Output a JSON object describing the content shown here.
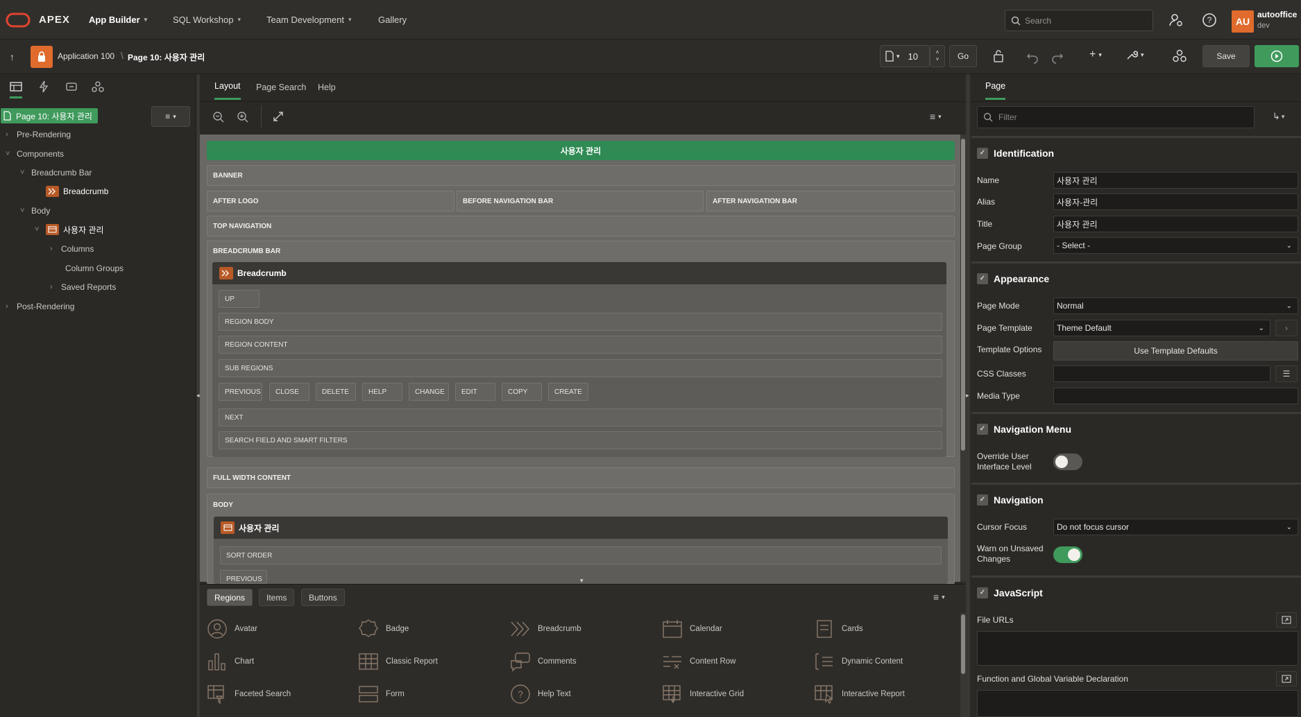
{
  "header": {
    "logo_text": "APEX",
    "nav": [
      {
        "label": "App Builder",
        "active": true
      },
      {
        "label": "SQL Workshop",
        "active": false
      },
      {
        "label": "Team Development",
        "active": false
      },
      {
        "label": "Gallery",
        "active": false
      }
    ],
    "search_placeholder": "Search",
    "user": {
      "initials": "AU",
      "name": "autooffice",
      "workspace": "dev"
    }
  },
  "toolbar": {
    "breadcrumb": [
      "Application 100",
      "Page 10: 사용자 관리"
    ],
    "page_number": "10",
    "go_label": "Go",
    "save_label": "Save",
    "colors": {
      "accent_green": "#3f9a5c",
      "brand_orange": "#e06b2c"
    }
  },
  "left_panel": {
    "page_chip": "Page 10: 사용자 관리",
    "tree": [
      {
        "label": "Pre-Rendering"
      },
      {
        "label": "Components"
      },
      {
        "label": "Breadcrumb Bar"
      },
      {
        "label": "Breadcrumb"
      },
      {
        "label": "Body"
      },
      {
        "label": "사용자 관리"
      },
      {
        "label": "Columns"
      },
      {
        "label": "Column Groups"
      },
      {
        "label": "Saved Reports"
      },
      {
        "label": "Post-Rendering"
      }
    ]
  },
  "center": {
    "tabs": [
      "Layout",
      "Page Search",
      "Help"
    ],
    "canvas": {
      "page_title": "사용자 관리",
      "zones": {
        "banner": "BANNER",
        "after_logo": "AFTER LOGO",
        "before_nav": "BEFORE NAVIGATION BAR",
        "after_nav": "AFTER NAVIGATION BAR",
        "top_nav": "TOP NAVIGATION",
        "breadcrumb_bar": "BREADCRUMB BAR",
        "full_width": "FULL WIDTH CONTENT",
        "body": "BODY"
      },
      "breadcrumb_region": {
        "title": "Breadcrumb",
        "up": "UP",
        "region_body": "REGION BODY",
        "region_content": "REGION CONTENT",
        "sub_regions": "SUB REGIONS",
        "buttons": [
          "PREVIOUS",
          "CLOSE",
          "DELETE",
          "HELP",
          "CHANGE",
          "EDIT",
          "COPY",
          "CREATE"
        ],
        "next": "NEXT",
        "search_field": "SEARCH FIELD AND SMART FILTERS"
      },
      "body_region": {
        "title": "사용자 관리",
        "sort_order": "SORT ORDER",
        "previous": "PREVIOUS"
      }
    },
    "gallery": {
      "tabs": [
        "Regions",
        "Items",
        "Buttons"
      ],
      "items": [
        {
          "label": "Avatar",
          "icon": "avatar-icon"
        },
        {
          "label": "Badge",
          "icon": "badge-icon"
        },
        {
          "label": "Breadcrumb",
          "icon": "breadcrumb-icon"
        },
        {
          "label": "Calendar",
          "icon": "calendar-icon"
        },
        {
          "label": "Cards",
          "icon": "cards-icon"
        },
        {
          "label": "Chart",
          "icon": "chart-icon"
        },
        {
          "label": "Classic Report",
          "icon": "classic-report-icon"
        },
        {
          "label": "Comments",
          "icon": "comments-icon"
        },
        {
          "label": "Content Row",
          "icon": "content-row-icon"
        },
        {
          "label": "Dynamic Content",
          "icon": "dynamic-content-icon"
        },
        {
          "label": "Faceted Search",
          "icon": "faceted-search-icon"
        },
        {
          "label": "Form",
          "icon": "form-icon"
        },
        {
          "label": "Help Text",
          "icon": "help-text-icon"
        },
        {
          "label": "Interactive Grid",
          "icon": "interactive-grid-icon"
        },
        {
          "label": "Interactive Report",
          "icon": "interactive-report-icon"
        }
      ]
    }
  },
  "right_panel": {
    "tab": "Page",
    "filter_placeholder": "Filter",
    "sections": {
      "identification": "Identification",
      "appearance": "Appearance",
      "navigation_menu": "Navigation Menu",
      "navigation": "Navigation",
      "javascript": "JavaScript"
    },
    "fields": {
      "name": {
        "label": "Name",
        "value": "사용자 관리"
      },
      "alias": {
        "label": "Alias",
        "value": "사용자-관리"
      },
      "title": {
        "label": "Title",
        "value": "사용자 관리"
      },
      "page_group": {
        "label": "Page Group",
        "value": "- Select -"
      },
      "page_mode": {
        "label": "Page Mode",
        "value": "Normal"
      },
      "page_template": {
        "label": "Page Template",
        "value": "Theme Default"
      },
      "template_options": {
        "label": "Template Options",
        "value": "Use Template Defaults"
      },
      "css_classes": {
        "label": "CSS Classes",
        "value": ""
      },
      "media_type": {
        "label": "Media Type",
        "value": ""
      },
      "override_ui_level": {
        "label_1": "Override User",
        "label_2": "Interface Level",
        "on": false
      },
      "cursor_focus": {
        "label": "Cursor Focus",
        "value": "Do not focus cursor"
      },
      "warn_unsaved": {
        "label_1": "Warn on Unsaved",
        "label_2": "Changes",
        "on": true
      },
      "file_urls": {
        "label": "File URLs"
      },
      "function_decl": {
        "label": "Function and Global Variable Declaration"
      }
    }
  }
}
